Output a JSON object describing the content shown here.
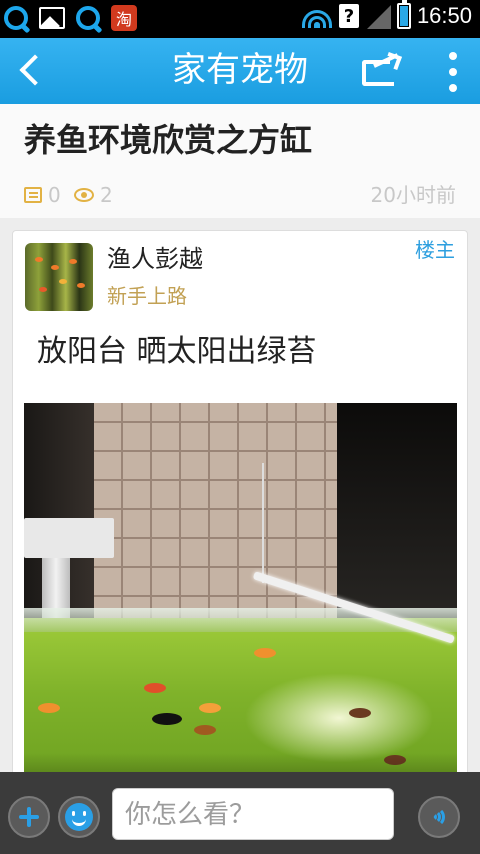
{
  "status_bar": {
    "time": "16:50",
    "app_icons": [
      "qq-icon",
      "gallery-icon",
      "qq-icon",
      "taobao-icon"
    ],
    "taobao_glyph": "淘",
    "unknown_glyph": "?"
  },
  "app_bar": {
    "title": "家有宠物",
    "back_icon": "back-arrow-icon",
    "share_icon": "share-icon",
    "more_icon": "more-vertical-icon"
  },
  "post": {
    "title": "养鱼环境欣赏之方缸",
    "comment_count": "0",
    "view_count": "2",
    "time_ago": "20小时前"
  },
  "card": {
    "author_name": "渔人彭越",
    "author_level": "新手上路",
    "op_tag": "楼主",
    "body_text": "放阳台 晒太阳出绿苔"
  },
  "bottom_bar": {
    "input_placeholder": "你怎么看？",
    "add_icon": "plus-icon",
    "emoji_icon": "smile-icon",
    "voice_icon": "voice-icon"
  },
  "colors": {
    "accent": "#1da7ec",
    "meta_icon": "#e2b244",
    "level_text": "#c2a154",
    "op_tag": "#2e9fdf"
  }
}
